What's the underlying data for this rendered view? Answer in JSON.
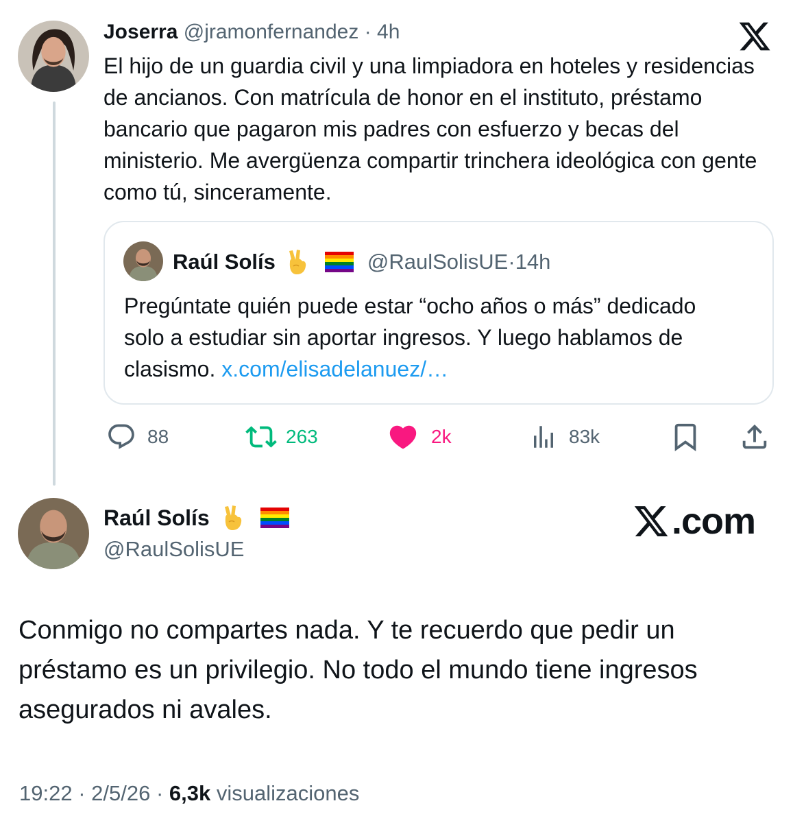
{
  "parent_tweet": {
    "author_name": "Joserra",
    "handle": "@jramonfernandez",
    "separator": " · ",
    "time": "4h",
    "text": "El hijo de un guardia civil y una limpiadora en hoteles y residencias de ancianos. Con matrícula de honor en el instituto, préstamo bancario que pagaron mis padres con esfuerzo y becas del ministerio. Me avergüenza compartir trinchera ideológica con gente como tú, sinceramente."
  },
  "quoted_tweet": {
    "author_name": "Raúl Solís",
    "handle": "@RaulSolisUE",
    "separator": " · ",
    "time": "14h",
    "text": "Pregúntate quién puede estar “ocho años o más” dedicado solo a estudiar sin aportar ingresos. Y luego hablamos de clasismo.",
    "link": "x.com/elisadelanuez/…"
  },
  "actions": {
    "replies": "88",
    "retweets": "263",
    "likes": "2k",
    "views": "83k"
  },
  "reply_tweet": {
    "author_name": "Raúl Solís",
    "handle": "@RaulSolisUE",
    "text": "Conmigo no compartes nada. Y te recuerdo que pedir un préstamo es un privilegio. No todo el mundo tiene ingresos asegurados ni avales.",
    "time": "19:22",
    "separator": " · ",
    "date": "2/5/26",
    "views_count": "6,3k",
    "views_label": "visualizaciones"
  },
  "watermark": {
    "text": ".com"
  },
  "colors": {
    "primary_text": "#0f1419",
    "secondary_text": "#536471",
    "link": "#1d9bf0",
    "retweet_green": "#00ba7c",
    "like_pink": "#f91880",
    "border": "#e1e8ed"
  },
  "icons": [
    "x-logo-icon",
    "reply-icon",
    "retweet-icon",
    "like-icon",
    "views-icon",
    "bookmark-icon",
    "share-icon",
    "victory-hand-emoji",
    "rainbow-flag-emoji"
  ]
}
